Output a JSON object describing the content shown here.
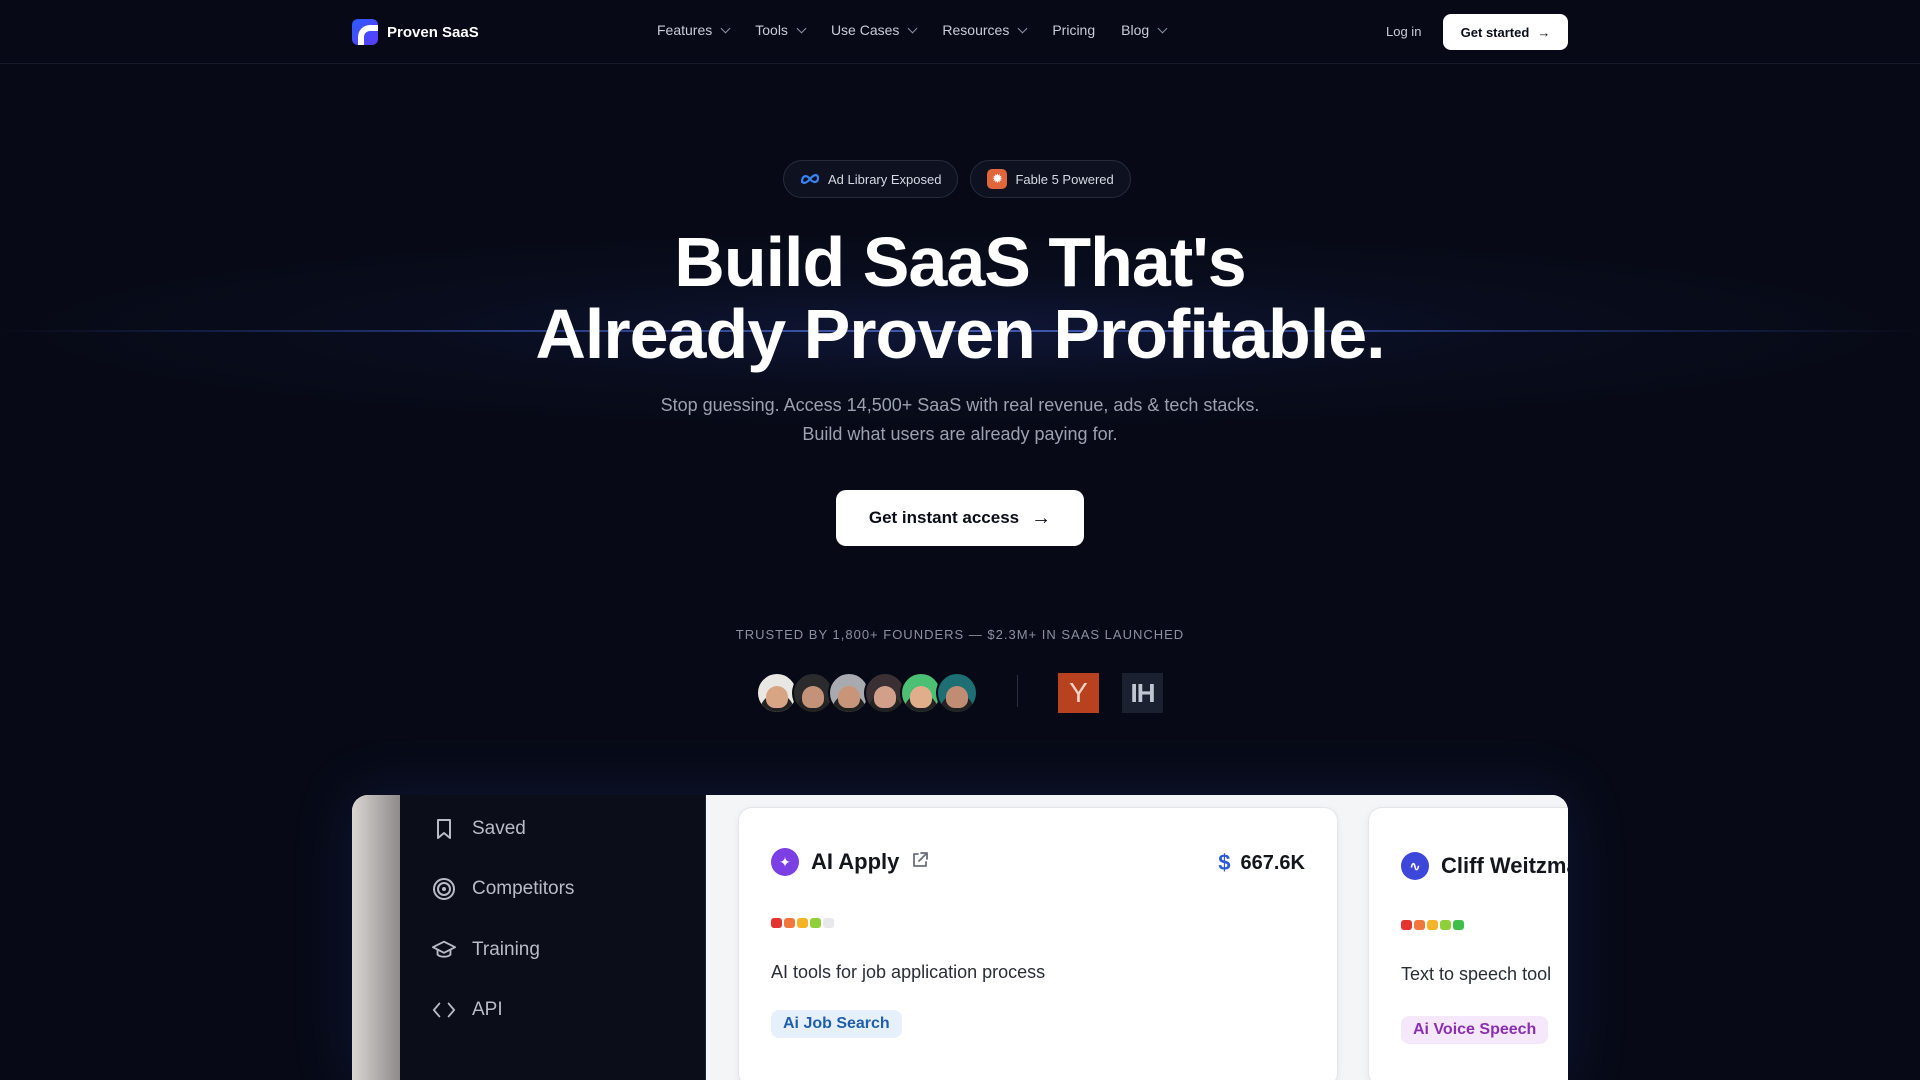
{
  "nav": {
    "brand": "Proven SaaS",
    "items": [
      {
        "label": "Features",
        "dropdown": true
      },
      {
        "label": "Tools",
        "dropdown": true
      },
      {
        "label": "Use Cases",
        "dropdown": true
      },
      {
        "label": "Resources",
        "dropdown": true
      },
      {
        "label": "Pricing",
        "dropdown": false
      },
      {
        "label": "Blog",
        "dropdown": true
      }
    ],
    "login": "Log in",
    "cta": "Get started"
  },
  "badges": [
    {
      "label": "Ad Library Exposed",
      "icon": "meta-icon"
    },
    {
      "label": "Fable 5 Powered",
      "icon": "sparkle-icon"
    }
  ],
  "hero": {
    "title_line1": "Build SaaS That's",
    "title_line2": "Already Proven Profitable.",
    "subtitle": "Stop guessing. Access 14,500+ SaaS with real revenue, ads & tech stacks. Build what users are already paying for.",
    "cta": "Get instant access"
  },
  "trust": {
    "text": "TRUSTED BY 1,800+ FOUNDERS — $2.3M+ IN SAAS LAUNCHED",
    "yc_letter": "Y",
    "ih_letters": "IH"
  },
  "preview": {
    "sidebar": [
      {
        "label": "Saved",
        "icon": "bookmark-icon"
      },
      {
        "label": "Competitors",
        "icon": "target-icon"
      },
      {
        "label": "Training",
        "icon": "graduation-cap-icon"
      },
      {
        "label": "API",
        "icon": "code-icon"
      }
    ],
    "cards": [
      {
        "name": "AI Apply",
        "revenue": "667.6K",
        "description": "AI tools for job application process",
        "tag": "Ai Job Search",
        "icon_color": "#7b3fe4",
        "tag_bg": "#e6f0fb",
        "tag_color": "#1f5fa8"
      },
      {
        "name": "Cliff Weitzma",
        "description": "Text to speech tool",
        "tag": "Ai Voice Speech",
        "icon_color": "#3d47d9",
        "tag_bg": "#f5e8fb",
        "tag_color": "#8a2fb0"
      }
    ]
  }
}
